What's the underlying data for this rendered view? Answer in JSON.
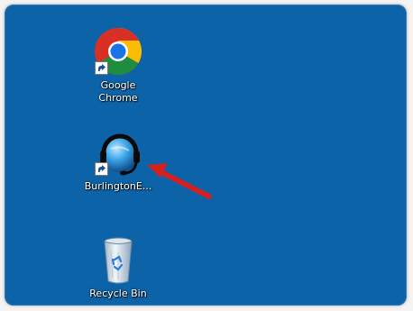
{
  "desktop": {
    "background_color": "#0d63a8",
    "icons": [
      {
        "label_line1": "Google",
        "label_line2": "Chrome",
        "icon": "chrome-icon",
        "shortcut": true
      },
      {
        "label": "BurlingtonE...",
        "icon": "burlington-globe-headset-icon",
        "shortcut": true
      },
      {
        "label": "Recycle Bin",
        "icon": "recycle-bin-icon",
        "shortcut": false
      }
    ],
    "annotation": {
      "icon": "red-arrow-icon",
      "color": "#d42020"
    }
  }
}
